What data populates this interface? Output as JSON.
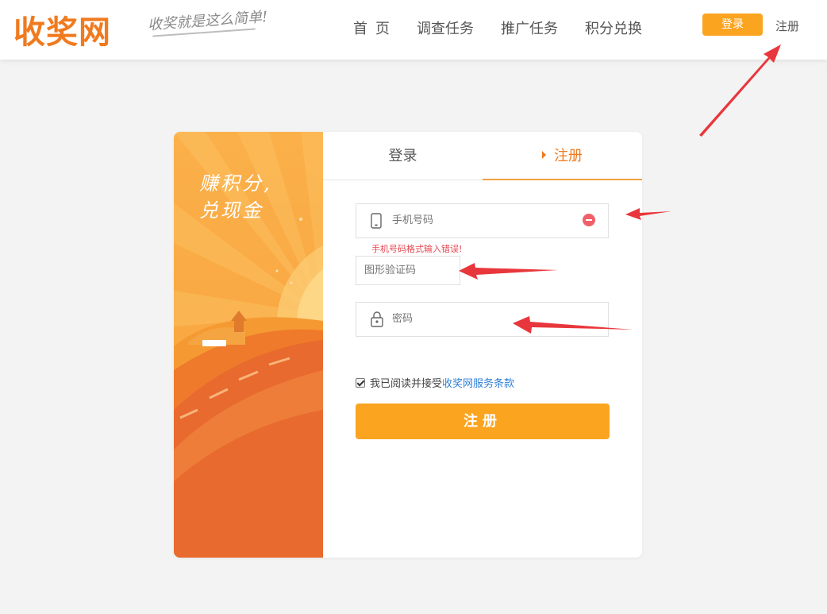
{
  "header": {
    "logo_text": "收奖网",
    "slogan": "收奖就是这么简单!",
    "nav": [
      {
        "label": "首页"
      },
      {
        "label": "调查任务"
      },
      {
        "label": "推广任务"
      },
      {
        "label": "积分兑换"
      }
    ],
    "login_label": "登录",
    "register_label": "注册"
  },
  "art": {
    "line1": "赚积分,",
    "line2": "兑现金"
  },
  "tabs": {
    "login": "登录",
    "register": "注册"
  },
  "form": {
    "phone_placeholder": "手机号码",
    "phone_error": "手机号码格式输入错误!",
    "captcha_placeholder": "图形验证码",
    "password_placeholder": "密码",
    "agree_text": "我已阅读并接受",
    "terms_link": "收奖网服务条款",
    "agree_checked": true,
    "submit_label": "注册"
  },
  "colors": {
    "brand_orange": "#f07a1e",
    "button_orange": "#fba420",
    "error_red": "#e8454f",
    "link_blue": "#2e7fd6",
    "annotation_arrow": "#e8373c"
  }
}
